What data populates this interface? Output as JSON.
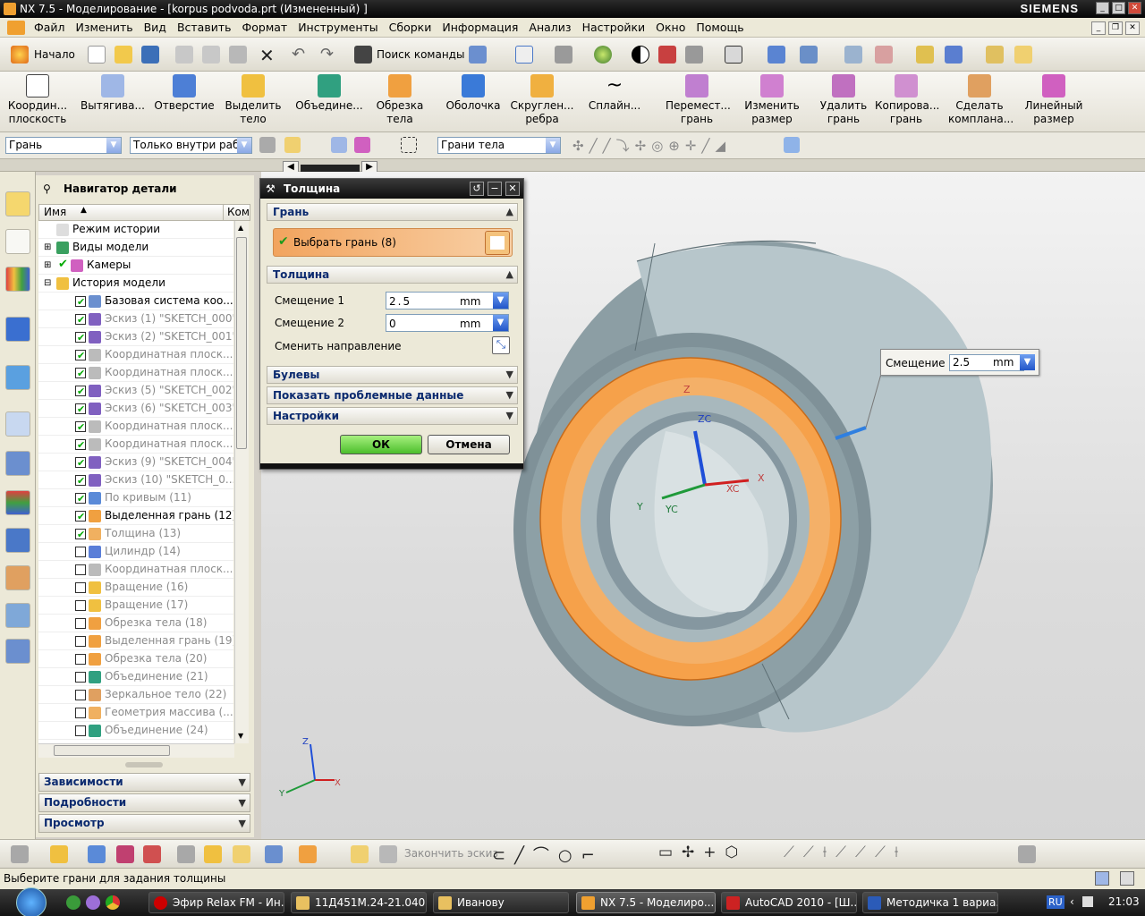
{
  "window": {
    "title": "NX 7.5 - Моделирование - [korpus podvoda.prt (Измененный) ]",
    "brand": "SIEMENS"
  },
  "menu": [
    "Файл",
    "Изменить",
    "Вид",
    "Вставить",
    "Формат",
    "Инструменты",
    "Сборки",
    "Информация",
    "Анализ",
    "Настройки",
    "Окно",
    "Помощь"
  ],
  "toolbar1": {
    "start_label": "Начало",
    "search_label": "Поиск команды"
  },
  "toolbar2": [
    {
      "label": "Координ... плоскость"
    },
    {
      "label": "Вытягива..."
    },
    {
      "label": "Отверстие"
    },
    {
      "label": "Выделить тело"
    },
    {
      "label": "Объедине..."
    },
    {
      "label": "Обрезка тела"
    },
    {
      "label": "Оболочка"
    },
    {
      "label": "Скруглен... ребра"
    },
    {
      "label": "Сплайн..."
    },
    {
      "label": "Перемест... грань"
    },
    {
      "label": "Изменить размер"
    },
    {
      "label": "Удалить грань"
    },
    {
      "label": "Копирова... грань"
    },
    {
      "label": "Сделать компланa..."
    },
    {
      "label": "Линейный размер"
    }
  ],
  "selection": {
    "filter": "Грань",
    "scope": "Только внутри рабо",
    "rule": "Грани тела"
  },
  "navigator": {
    "title": "Навигатор детали",
    "col_name": "Имя",
    "col_comment": "Ком",
    "rows": [
      {
        "label": "Режим истории",
        "state": "none",
        "grey": false
      },
      {
        "label": "Виды модели",
        "state": "none",
        "grey": false
      },
      {
        "label": "Камеры",
        "state": "on",
        "grey": false
      },
      {
        "label": "История модели",
        "state": "none",
        "grey": false
      },
      {
        "label": "Базовая система коо...",
        "state": "on",
        "grey": false
      },
      {
        "label": "Эскиз (1) \"SKETCH_000\"",
        "state": "on",
        "grey": true
      },
      {
        "label": "Эскиз (2) \"SKETCH_001\"",
        "state": "on",
        "grey": true
      },
      {
        "label": "Координатная плоск...",
        "state": "on",
        "grey": true
      },
      {
        "label": "Координатная плоск...",
        "state": "on",
        "grey": true
      },
      {
        "label": "Эскиз (5) \"SKETCH_002\"",
        "state": "on",
        "grey": true
      },
      {
        "label": "Эскиз (6) \"SKETCH_003\"",
        "state": "on",
        "grey": true
      },
      {
        "label": "Координатная плоск...",
        "state": "on",
        "grey": true
      },
      {
        "label": "Координатная плоск...",
        "state": "on",
        "grey": true
      },
      {
        "label": "Эскиз (9) \"SKETCH_004\"",
        "state": "on",
        "grey": true
      },
      {
        "label": "Эскиз (10) \"SKETCH_0...",
        "state": "on",
        "grey": true
      },
      {
        "label": "По кривым (11)",
        "state": "on",
        "grey": true
      },
      {
        "label": "Выделенная грань (12)",
        "state": "on",
        "grey": false
      },
      {
        "label": "Толщина (13)",
        "state": "on",
        "grey": true
      },
      {
        "label": "Цилиндр (14)",
        "state": "off",
        "grey": true
      },
      {
        "label": "Координатная плоск...",
        "state": "off",
        "grey": true
      },
      {
        "label": "Вращение (16)",
        "state": "off",
        "grey": true
      },
      {
        "label": "Вращение (17)",
        "state": "off",
        "grey": true
      },
      {
        "label": "Обрезка тела (18)",
        "state": "off",
        "grey": true
      },
      {
        "label": "Выделенная грань (19)",
        "state": "off",
        "grey": true
      },
      {
        "label": "Обрезка тела (20)",
        "state": "off",
        "grey": true
      },
      {
        "label": "Объединение (21)",
        "state": "off",
        "grey": true
      },
      {
        "label": "Зеркальное тело (22)",
        "state": "off",
        "grey": true
      },
      {
        "label": "Геометрия массива (...",
        "state": "off",
        "grey": true
      },
      {
        "label": "Объединение (24)",
        "state": "off",
        "grey": true
      }
    ],
    "sections": [
      "Зависимости",
      "Подробности",
      "Просмотр"
    ]
  },
  "dialog": {
    "title": "Толщина",
    "sec_face": "Грань",
    "select_face": "Выбрать грань (8)",
    "sec_thickness": "Толщина",
    "offset1_label": "Смещение 1",
    "offset1_value": "2.5",
    "offset2_label": "Смещение 2",
    "offset2_value": "0",
    "unit": "mm",
    "reverse_label": "Сменить направление",
    "sec_boolean": "Булевы",
    "sec_problem": "Показать проблемные данные",
    "sec_settings": "Настройки",
    "ok": "ОК",
    "cancel": "Отмена"
  },
  "onscreen_input": {
    "label": "Смещение 1",
    "value": "2.5",
    "unit": "mm"
  },
  "axis_labels": {
    "z": "Z",
    "zc": "ZC",
    "x": "X",
    "xc": "XC",
    "y": "Y",
    "yc": "YC"
  },
  "bottom_toolbar": {
    "finish_sketch": "Закончить эскиз"
  },
  "status": "Выберите грани для задания толщины",
  "taskbar": {
    "items": [
      "Эфир Relax FM - Ин...",
      "11Д451М.24-21.040 ...",
      "Иванову",
      "NX 7.5 - Моделиро...",
      "AutoCAD 2010 - [Ш...",
      "Методичка 1 вариа..."
    ],
    "lang": "RU",
    "clock": "21:03"
  },
  "colors": {
    "accent_orange": "#f6a14a",
    "model_grey": "#9fb0b6",
    "title_dark": "#111111"
  }
}
